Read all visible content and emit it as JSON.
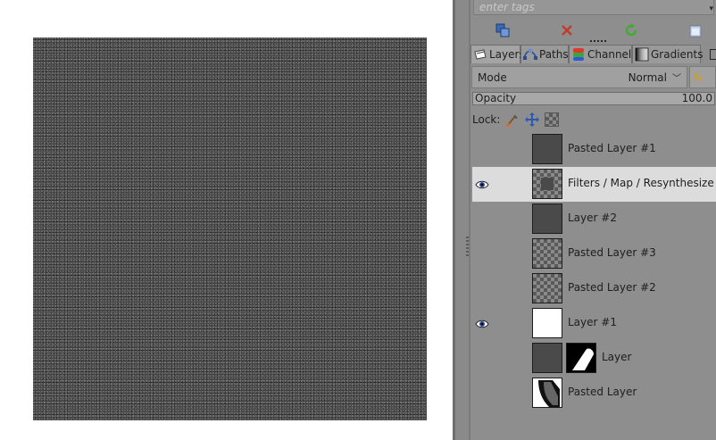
{
  "tags": {
    "placeholder": "enter tags"
  },
  "tabs": [
    {
      "label": "Layers",
      "icon": "layers-icon"
    },
    {
      "label": "Paths",
      "icon": "paths-icon"
    },
    {
      "label": "Channels",
      "icon": "channels-icon"
    },
    {
      "label": "Gradients",
      "icon": "gradients-icon"
    }
  ],
  "mode": {
    "label": "Mode",
    "value": "Normal"
  },
  "opacity": {
    "label": "Opacity",
    "value": "100.0"
  },
  "lock": {
    "label": "Lock:"
  },
  "layers": [
    {
      "name": "Pasted Layer #1",
      "visible": false,
      "thumb": "dark",
      "selected": false
    },
    {
      "name": "Filters / Map / Resynthesize",
      "visible": true,
      "thumb": "checker-center",
      "selected": true
    },
    {
      "name": "Layer #2",
      "visible": false,
      "thumb": "dark",
      "selected": false
    },
    {
      "name": "Pasted Layer #3",
      "visible": false,
      "thumb": "checker",
      "selected": false
    },
    {
      "name": "Pasted Layer #2",
      "visible": false,
      "thumb": "checker",
      "selected": false
    },
    {
      "name": "Layer #1",
      "visible": true,
      "thumb": "white",
      "selected": false
    },
    {
      "name": "Layer",
      "visible": false,
      "thumb": "dark",
      "mask": true,
      "selected": false
    },
    {
      "name": "Pasted Layer",
      "visible": false,
      "thumb": "diagonal",
      "selected": false
    }
  ],
  "colors": {
    "selected_row": "#dcdcdc",
    "panel": "#8e8e8e"
  }
}
